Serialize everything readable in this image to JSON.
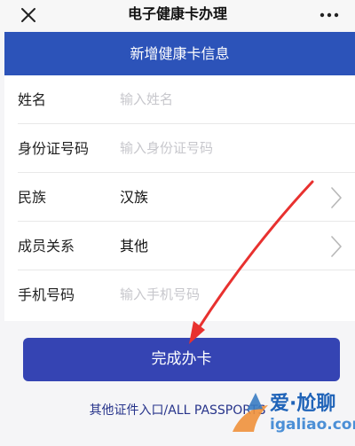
{
  "titlebar": {
    "close_icon": "close-icon",
    "title": "电子健康卡办理",
    "more_icon": "more-icon"
  },
  "banner": {
    "title": "新增健康卡信息"
  },
  "form": {
    "rows": [
      {
        "label": "姓名",
        "placeholder": "输入姓名"
      },
      {
        "label": "身份证号码",
        "placeholder": "输入身份证号码"
      },
      {
        "label": "民族",
        "value": "汉族",
        "icon": "chevron-right-icon"
      },
      {
        "label": "成员关系",
        "value": "其他",
        "icon": "chevron-right-icon"
      },
      {
        "label": "手机号码",
        "placeholder": "输入手机号码"
      }
    ]
  },
  "submit": {
    "label": "完成办卡"
  },
  "alt_link": {
    "label": "其他证件入口/ALL PASSPORTS"
  },
  "watermark": {
    "brand": "爱·尬聊",
    "url": "igaliao.com"
  },
  "colors": {
    "banner": "#2c53b9",
    "button": "#3544b3",
    "link": "#27348b",
    "arrow": "#e8312f"
  }
}
